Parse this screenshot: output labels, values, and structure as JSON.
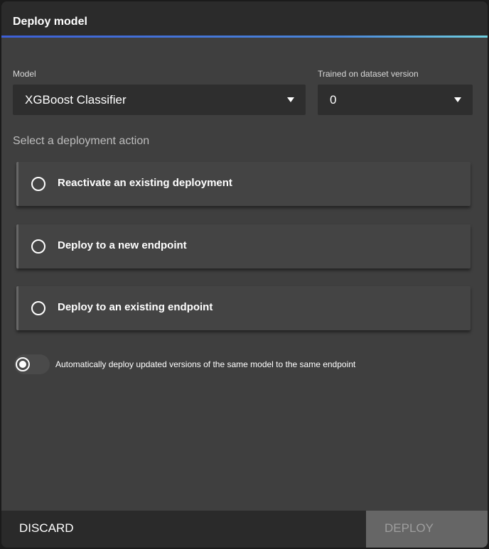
{
  "dialog": {
    "title": "Deploy model"
  },
  "model": {
    "label": "Model",
    "value": "XGBoost Classifier"
  },
  "dataset_version": {
    "label": "Trained on dataset version",
    "value": "0"
  },
  "deployment_action": {
    "label": "Select a deployment action",
    "options": [
      {
        "label": "Reactivate an existing deployment",
        "selected": false
      },
      {
        "label": "Deploy to a new endpoint",
        "selected": false
      },
      {
        "label": "Deploy to an existing endpoint",
        "selected": false
      }
    ]
  },
  "auto_deploy": {
    "label": "Automatically deploy updated versions of the same model to the same endpoint",
    "checked": true
  },
  "footer": {
    "discard_label": "DISCARD",
    "deploy_label": "DEPLOY"
  },
  "colors": {
    "accent_start": "#3d5fd6",
    "accent_end": "#6fd0e0",
    "background": "#3f3f3f"
  }
}
